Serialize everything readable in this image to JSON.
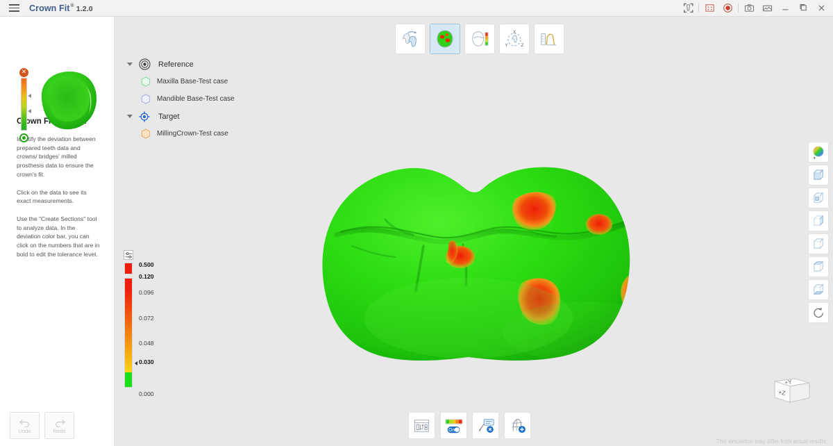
{
  "titlebar": {
    "menu_icon": "hamburger-menu-icon",
    "app_name": "Crown Fit",
    "trademark": "®",
    "version": "1.2.0",
    "buttons": [
      {
        "name": "scan-compare-icon",
        "label": "Scan Compare"
      },
      {
        "name": "crop-region-icon",
        "label": "Crop Region"
      },
      {
        "name": "record-icon",
        "label": "Record"
      },
      {
        "name": "screenshot-icon",
        "label": "Screenshot"
      },
      {
        "name": "gallery-icon",
        "label": "Gallery"
      },
      {
        "name": "minimize-icon",
        "label": "Minimize"
      },
      {
        "name": "maximize-icon",
        "label": "Maximize"
      },
      {
        "name": "close-icon",
        "label": "Close"
      }
    ]
  },
  "sidebar": {
    "title": "Crown Fitting Test",
    "paragraphs": [
      "Identify the deviation between prepared teeth data and crowns/ bridges' milled prosthesis data to ensure the crown's fit.",
      "Click on the data to see its exact measurements.",
      "Use the \"Create Sections\" tool to analyze data. In the deviation color bar, you can click on the numbers that are in bold to edit the tolerance level."
    ],
    "undo_label": "Undo",
    "redo_label": "Redo"
  },
  "toolbar_top": [
    {
      "name": "align-data-button",
      "label": "Align Data",
      "active": false
    },
    {
      "name": "deviation-map-button",
      "label": "Deviation Map",
      "active": true
    },
    {
      "name": "color-scale-button",
      "label": "Color Scale",
      "active": false
    },
    {
      "name": "rotate-axes-button",
      "label": "Rotate Axes",
      "active": false
    },
    {
      "name": "measure-profile-button",
      "label": "Measure Profile",
      "active": false
    }
  ],
  "tree": {
    "groups": [
      {
        "label": "Reference",
        "icon": "reference-target-icon",
        "expanded": true,
        "children": [
          {
            "label": "Maxilla Base-Test case",
            "color": "#8fe3a8"
          },
          {
            "label": "Mandible Base-Test case",
            "color": "#b0b4ea"
          }
        ]
      },
      {
        "label": "Target",
        "icon": "target-crosshair-icon",
        "expanded": true,
        "children": [
          {
            "label": "MillingCrown-Test case",
            "color": "#f5c78a"
          }
        ]
      }
    ]
  },
  "legend": {
    "settings_icon": "tolerance-settings-icon",
    "ticks": [
      {
        "value": "0.500",
        "bold": true,
        "marker": false
      },
      {
        "value": "0.120",
        "bold": true,
        "marker": false
      },
      {
        "value": "0.096",
        "bold": false,
        "marker": false
      },
      {
        "value": "0.072",
        "bold": false,
        "marker": false
      },
      {
        "value": "0.048",
        "bold": false,
        "marker": false
      },
      {
        "value": "0.030",
        "bold": true,
        "marker": true
      },
      {
        "value": "0.000",
        "bold": false,
        "marker": false
      }
    ]
  },
  "right_toolbar": [
    {
      "name": "color-wheel-button",
      "label": "Color Settings"
    },
    {
      "name": "view-front-button",
      "label": "Front View"
    },
    {
      "name": "view-back-button",
      "label": "Back View"
    },
    {
      "name": "view-left-button",
      "label": "Left View"
    },
    {
      "name": "view-right-button",
      "label": "Right View"
    },
    {
      "name": "view-top-button",
      "label": "Top View"
    },
    {
      "name": "view-bottom-button",
      "label": "Bottom View"
    },
    {
      "name": "reset-view-button",
      "label": "Reset View"
    }
  ],
  "navcube": {
    "top_face": "+Y",
    "front_face": "+Z"
  },
  "toolbar_bottom": [
    {
      "name": "data-panel-button",
      "label": "Data Panel"
    },
    {
      "name": "color-bar-toggle-button",
      "label": "Color Bar",
      "toggle": "On"
    },
    {
      "name": "delete-annotation-button",
      "label": "Delete Annotation"
    },
    {
      "name": "create-section-button",
      "label": "Create Sections"
    }
  ],
  "disclaimer": "This simulation may differ from actual results.",
  "colors": {
    "accent": "#3f5f8f",
    "active_tool": "#d7e8f5",
    "deviation_high": "#ee1d0e",
    "deviation_low": "#17e017",
    "record": "#d13c2e"
  }
}
